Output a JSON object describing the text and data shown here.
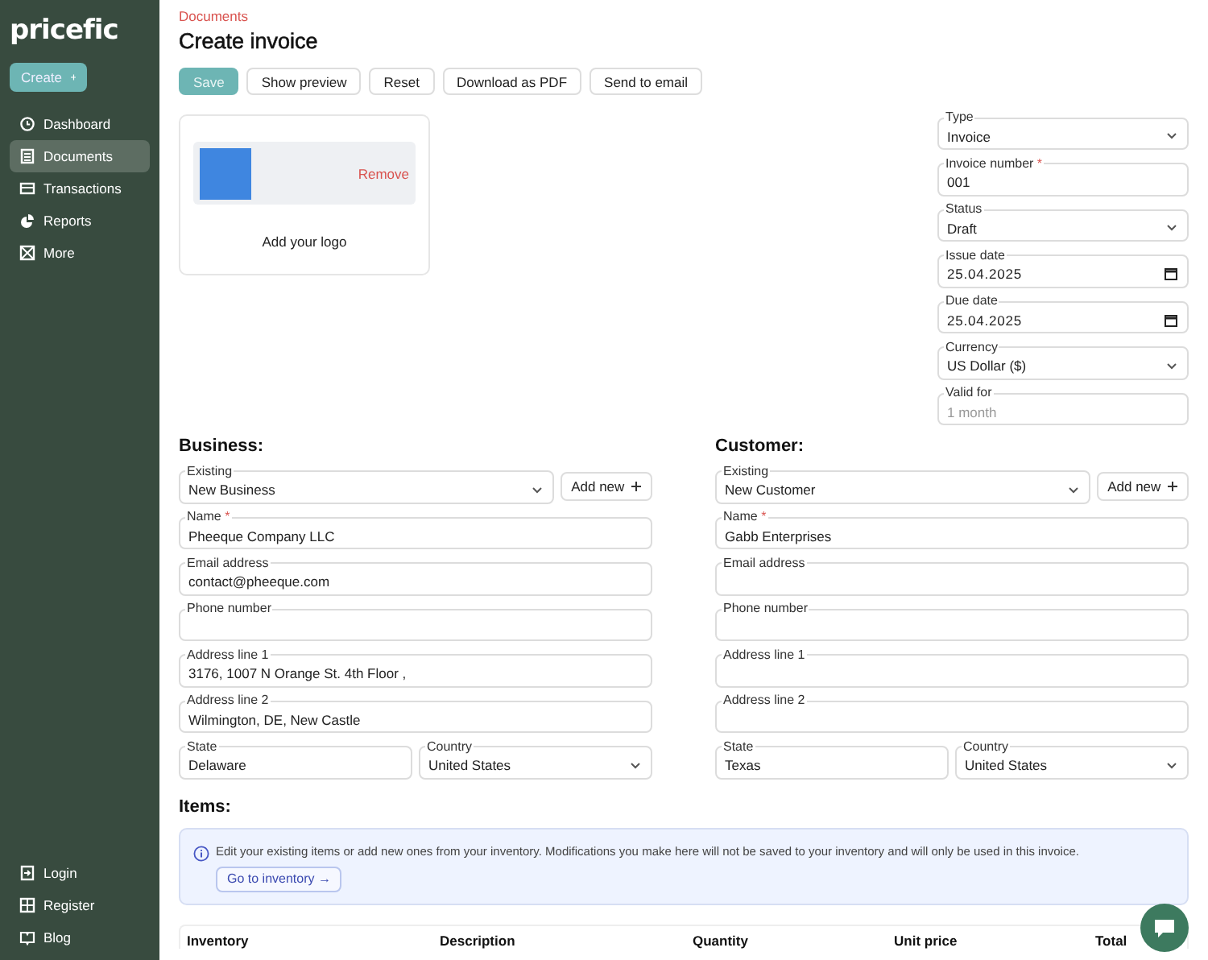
{
  "sidebar": {
    "logo": "pricefic",
    "create_button": "Create",
    "nav": [
      {
        "label": "Dashboard",
        "selected": false
      },
      {
        "label": "Documents",
        "selected": true
      },
      {
        "label": "Transactions",
        "selected": false
      },
      {
        "label": "Reports",
        "selected": false
      },
      {
        "label": "More",
        "selected": false
      }
    ],
    "footer": [
      {
        "label": "Login"
      },
      {
        "label": "Register"
      },
      {
        "label": "Blog"
      }
    ]
  },
  "header": {
    "breadcrumb": "Documents",
    "title": "Create invoice",
    "toolbar": [
      {
        "label": "Save",
        "kind": "primary"
      },
      {
        "label": "Show preview",
        "kind": "secondary"
      },
      {
        "label": "Reset",
        "kind": "secondary"
      },
      {
        "label": "Download as PDF",
        "kind": "secondary"
      },
      {
        "label": "Send to email",
        "kind": "secondary"
      }
    ]
  },
  "logo_card": {
    "remove": "Remove",
    "caption": "Add your logo"
  },
  "invoice_fields": [
    {
      "label": "Type",
      "kind": "select",
      "value": "Invoice"
    },
    {
      "label": "Invoice number",
      "required_mark": "*",
      "value": "001"
    },
    {
      "label": "Status",
      "kind": "select",
      "value": "Draft"
    },
    {
      "label": "Issue date",
      "kind": "date",
      "value": "25.04.2025"
    },
    {
      "label": "Due date",
      "kind": "date",
      "value": "25.04.2025"
    },
    {
      "label": "Currency",
      "kind": "select",
      "value": "US Dollar ($)"
    },
    {
      "label": "Valid for",
      "placeholder": "1 month"
    }
  ],
  "parties": [
    {
      "heading": "Business:",
      "existing": {
        "label": "Existing",
        "kind": "select",
        "value": "New Business"
      },
      "add_new": "Add new",
      "fields": [
        {
          "label": "Name",
          "required_mark": "*",
          "value": "Pheeque Company LLC"
        },
        {
          "label": "Email address",
          "value": "contact@pheeque.com"
        },
        {
          "label": "Phone number"
        },
        {
          "label": "Address line 1",
          "value": "3176, 1007 N Orange St. 4th Floor ,"
        },
        {
          "label": "Address line 2",
          "value": "Wilmington, DE, New Castle"
        }
      ],
      "state": {
        "label": "State",
        "value": "Delaware"
      },
      "country": {
        "label": "Country",
        "kind": "select",
        "value": "United States"
      }
    },
    {
      "heading": "Customer:",
      "existing": {
        "label": "Existing",
        "kind": "select",
        "value": "New Customer"
      },
      "add_new": "Add new",
      "fields": [
        {
          "label": "Name",
          "required_mark": "*",
          "value": "Gabb Enterprises"
        },
        {
          "label": "Email address"
        },
        {
          "label": "Phone number"
        },
        {
          "label": "Address line 1"
        },
        {
          "label": "Address line 2"
        }
      ],
      "state": {
        "label": "State",
        "value": "Texas"
      },
      "country": {
        "label": "Country",
        "kind": "select",
        "value": "United States"
      }
    }
  ],
  "items": {
    "heading": "Items:",
    "notice": "Edit your existing items or add new ones from your inventory. Modifications you make here will not be saved to your inventory and will only be used in this invoice.",
    "inventory_button": "Go to inventory →",
    "columns": [
      "Inventory",
      "Description",
      "Quantity",
      "Unit price",
      "Total"
    ]
  }
}
